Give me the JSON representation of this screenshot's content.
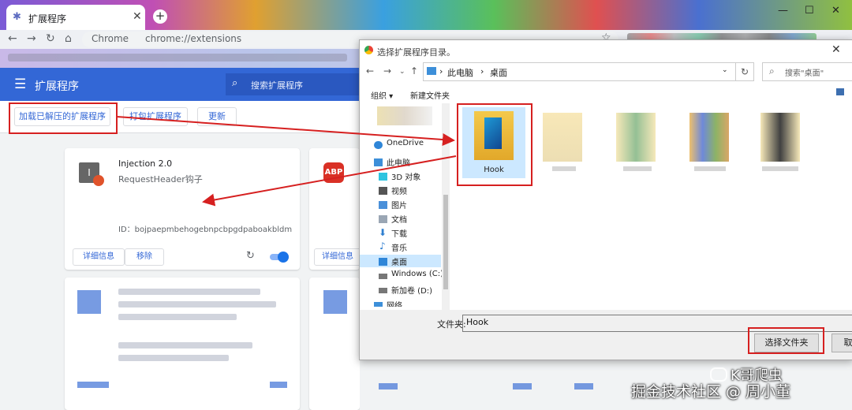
{
  "browser": {
    "tab_title": "扩展程序",
    "omnibox_site": "Chrome",
    "omnibox_url": "chrome://extensions"
  },
  "extensions_page": {
    "title": "扩展程序",
    "search_placeholder": "搜索扩展程序",
    "dev_buttons": [
      "加载已解压的扩展程序",
      "打包扩展程序",
      "更新"
    ],
    "card1": {
      "icon_letter": "I",
      "name": "Injection  2.0",
      "description": "RequestHeader钩子",
      "id": "ID：bojpaepmbehogebnpcbpgdpaboakbldm",
      "details_label": "详细信息",
      "remove_label": "移除",
      "enabled": true
    },
    "card2": {
      "icon_text": "ABP",
      "details_label": "详细信息"
    }
  },
  "dialog": {
    "title": "选择扩展程序目录。",
    "breadcrumb": [
      "此电脑",
      "桌面"
    ],
    "search_placeholder": "搜索\"桌面\"",
    "organize_label": "组织 ▾",
    "new_folder_label": "新建文件夹",
    "nav_items": [
      {
        "label": "OneDrive",
        "icon": "cloud-icon"
      },
      {
        "label": "此电脑",
        "icon": "computer-icon"
      },
      {
        "label": "3D 对象",
        "icon": "3d-objects-icon"
      },
      {
        "label": "视频",
        "icon": "video-icon"
      },
      {
        "label": "图片",
        "icon": "pictures-icon"
      },
      {
        "label": "文档",
        "icon": "documents-icon"
      },
      {
        "label": "下载",
        "icon": "download-icon"
      },
      {
        "label": "音乐",
        "icon": "music-icon"
      },
      {
        "label": "桌面",
        "icon": "desktop-icon",
        "selected": true
      },
      {
        "label": "Windows (C:)",
        "icon": "drive-icon"
      },
      {
        "label": "新加卷 (D:)",
        "icon": "drive-icon"
      },
      {
        "label": "网络",
        "icon": "network-icon"
      }
    ],
    "selected_folder": "Hook",
    "folder_field_label": "文件夹:",
    "folder_field_value": "Hook",
    "select_button": "选择文件夹",
    "cancel_button": "取"
  },
  "watermark": {
    "wechat": "K哥爬虫",
    "site": "掘金技术社区 @ 周小董"
  },
  "colors": {
    "accent": "#3367d6",
    "annotation_red": "#d62020"
  }
}
